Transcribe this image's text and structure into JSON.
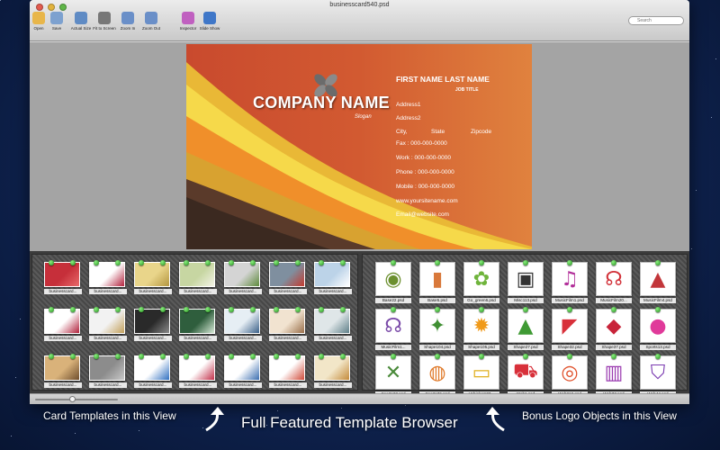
{
  "window": {
    "title": "businesscard540.psd"
  },
  "toolbar": {
    "buttons": [
      {
        "label": "Open",
        "icon": "folder-icon",
        "color": "#e8b64a"
      },
      {
        "label": "Save",
        "icon": "save-icon",
        "color": "#7da1cf"
      },
      {
        "label": "Actual Size",
        "icon": "actual-size-icon",
        "color": "#5f8bc4"
      },
      {
        "label": "Fit to Screen",
        "icon": "fit-screen-icon",
        "color": "#777777"
      },
      {
        "label": "Zoom In",
        "icon": "zoom-in-icon",
        "color": "#6a8fc8"
      },
      {
        "label": "Zoom Out",
        "icon": "zoom-out-icon",
        "color": "#6a8fc8"
      },
      {
        "label": "Inspector",
        "icon": "inspector-icon",
        "color": "#c060c0"
      },
      {
        "label": "Slide Show",
        "icon": "slideshow-icon",
        "color": "#3f77c8"
      }
    ],
    "search_placeholder": "Search"
  },
  "card": {
    "company": "COMPANY NAME",
    "slogan": "Slogan",
    "name": "FIRST NAME LAST NAME",
    "job_title": "JOB TITLE",
    "address1": "Address1",
    "address2": "Address2",
    "city": "City,",
    "state": "State",
    "zipcode": "Zipcode",
    "fax": "Fax      :  000-000-0000",
    "work": "Work    :  000-000-0000",
    "phone": "Phone   :  000-000-0000",
    "mobile": "Mobile  :  000-000-0000",
    "website": "www.yoursitename.com",
    "email": "Email@website.com"
  },
  "templates": [
    {
      "caption": "businesscard...",
      "colors": [
        "#c62f3a",
        "#e86a6a"
      ]
    },
    {
      "caption": "businesscard...",
      "colors": [
        "#ffffff",
        "#b3213c"
      ]
    },
    {
      "caption": "businesscard...",
      "colors": [
        "#e9d58a",
        "#b4963f"
      ]
    },
    {
      "caption": "businesscard...",
      "colors": [
        "#c7d6a2",
        "#f3f3e6"
      ]
    },
    {
      "caption": "businesscard...",
      "colors": [
        "#d4d4d4",
        "#5d8a3a"
      ]
    },
    {
      "caption": "businesscard...",
      "colors": [
        "#7f8f9f",
        "#c43a2f"
      ]
    },
    {
      "caption": "businesscard...",
      "colors": [
        "#bcd3e8",
        "#ffffff"
      ]
    },
    {
      "caption": "businesscard...",
      "colors": [
        "#ffffff",
        "#b0203a"
      ]
    },
    {
      "caption": "businesscard...",
      "colors": [
        "#f2f2f2",
        "#c3a05a"
      ]
    },
    {
      "caption": "businesscard...",
      "colors": [
        "#2a2a2a",
        "#8a8a8a"
      ]
    },
    {
      "caption": "businesscard...",
      "colors": [
        "#2f5e3d",
        "#d7e9d6"
      ]
    },
    {
      "caption": "businesscard...",
      "colors": [
        "#e6eef4",
        "#3a5f88"
      ]
    },
    {
      "caption": "businesscard...",
      "colors": [
        "#f1e3d0",
        "#9a6f4a"
      ]
    },
    {
      "caption": "businesscard...",
      "colors": [
        "#dfe6e8",
        "#5f7f88"
      ]
    },
    {
      "caption": "businesscard...",
      "colors": [
        "#d9b27a",
        "#6e4d2d"
      ]
    },
    {
      "caption": "businesscard...",
      "colors": [
        "#8c8c8c",
        "#c8c8c8"
      ]
    },
    {
      "caption": "businesscard...",
      "colors": [
        "#ffffff",
        "#2f6fc0"
      ]
    },
    {
      "caption": "businesscard...",
      "colors": [
        "#ffffff",
        "#c3304a"
      ]
    },
    {
      "caption": "businesscard...",
      "colors": [
        "#ffffff",
        "#3a6db0"
      ]
    },
    {
      "caption": "businesscard...",
      "colors": [
        "#ffffff",
        "#d14b3a"
      ]
    },
    {
      "caption": "businesscard...",
      "colors": [
        "#f2e6c8",
        "#c48a3a"
      ]
    }
  ],
  "logos": [
    {
      "caption": "Base22.psd",
      "glyph": "◉",
      "color": "#6b8f2e"
    },
    {
      "caption": "Base5.psd",
      "glyph": "▮",
      "color": "#d9793b"
    },
    {
      "caption": "Go_green6.psd",
      "glyph": "✿",
      "color": "#6fb43c"
    },
    {
      "caption": "Misc113.psd",
      "glyph": "▣",
      "color": "#333333"
    },
    {
      "caption": "MusicFilm1.psd",
      "glyph": "♫",
      "color": "#b2309a"
    },
    {
      "caption": "MusicFilm20...",
      "glyph": "☊",
      "color": "#d2323a"
    },
    {
      "caption": "MusicFilm4.psd",
      "glyph": "▲",
      "color": "#c2363a"
    },
    {
      "caption": "MusicFilm1...",
      "glyph": "☊",
      "color": "#7a4aa8"
    },
    {
      "caption": "Shape104.psd",
      "glyph": "✦",
      "color": "#3f8f32"
    },
    {
      "caption": "Shape105.psd",
      "glyph": "✹",
      "color": "#f09a1a"
    },
    {
      "caption": "Shape27.psd",
      "glyph": "▲",
      "color": "#3f9a34"
    },
    {
      "caption": "Shape32.psd",
      "glyph": "◤",
      "color": "#d8303a"
    },
    {
      "caption": "Shape37.psd",
      "glyph": "◆",
      "color": "#c8243a"
    },
    {
      "caption": "Sports13.psd",
      "glyph": "●",
      "color": "#e03a9a"
    },
    {
      "caption": "Sports27.psd",
      "glyph": "✕",
      "color": "#4a8a3a"
    },
    {
      "caption": "Sports36.psd",
      "glyph": "◍",
      "color": "#e07a2a"
    },
    {
      "caption": "Vehicles103...",
      "glyph": "▭",
      "color": "#e0b020"
    },
    {
      "caption": "Web1.psd",
      "glyph": "⛟",
      "color": "#d8303a"
    },
    {
      "caption": "Web216.psd",
      "glyph": "◎",
      "color": "#e0502a"
    },
    {
      "caption": "Web32.psd",
      "glyph": "▥",
      "color": "#9a3ab0"
    },
    {
      "caption": "Web44.psd",
      "glyph": "⛉",
      "color": "#7a3ab0"
    }
  ],
  "zoom_slider": {
    "value": 0.45
  },
  "captions": {
    "left": "Card Templates in this View",
    "middle": "Full Featured  Template Browser",
    "right": "Bonus Logo Objects in this View"
  }
}
